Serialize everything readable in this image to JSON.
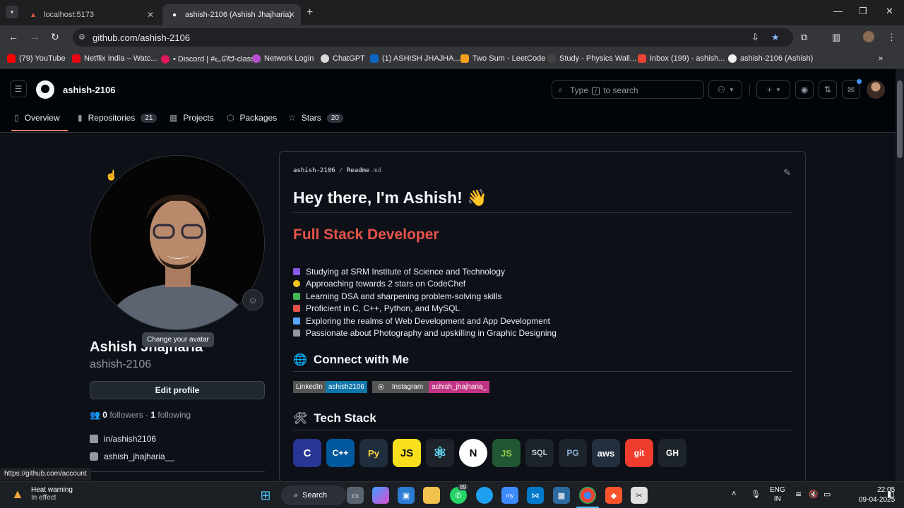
{
  "browser": {
    "tabs": [
      {
        "title": "localhost:5173",
        "active": false
      },
      {
        "title": "ashish-2106 (Ashish Jhajharia)",
        "active": true
      }
    ],
    "url": "github.com/ashish-2106",
    "bookmarks": [
      {
        "label": "(79) YouTube",
        "color": "#ff0000"
      },
      {
        "label": "Netflix India – Watc...",
        "color": "#e50914"
      },
      {
        "label": "• Discord | #ᓚᘏᗢ-class...",
        "color": "#e3165b"
      },
      {
        "label": "Network Login",
        "color": "#b84fd0"
      },
      {
        "label": "ChatGPT",
        "color": "#d9d9d9"
      },
      {
        "label": "(1) ASHISH JHAJHA...",
        "color": "#0a66c2"
      },
      {
        "label": "Two Sum - LeetCode",
        "color": "#f89f1b"
      },
      {
        "label": "Study - Physics Wall...",
        "color": "#444444"
      },
      {
        "label": "Inbox (199) - ashish...",
        "color": "#ea4335"
      },
      {
        "label": "ashish-2106 (Ashish)",
        "color": "#f0f0f0"
      }
    ]
  },
  "github": {
    "username": "ashish-2106",
    "search_placeholder_before": "Type",
    "search_key": "/",
    "search_placeholder_after": "to search",
    "tabs": [
      {
        "label": "Overview",
        "icon": "book-icon"
      },
      {
        "label": "Repositories",
        "icon": "repo-icon",
        "count": "21"
      },
      {
        "label": "Projects",
        "icon": "table-icon"
      },
      {
        "label": "Packages",
        "icon": "package-icon"
      },
      {
        "label": "Stars",
        "icon": "star-icon",
        "count": "20"
      }
    ]
  },
  "profile": {
    "name": "Ashish Jhajharia",
    "login": "ashish-2106",
    "tooltip": "Change your avatar",
    "edit_label": "Edit profile",
    "followers": "0",
    "followers_label": "followers",
    "following": "1",
    "following_label": "following",
    "linkedin": "in/ashish2106",
    "instagram": "ashish_jhajharia__"
  },
  "readme": {
    "path_user": "ashish-2106",
    "path_sep": "/",
    "path_file": "Readme",
    "path_ext": ".md",
    "heading": "Hey there, I'm Ashish! 👋",
    "role": "Full Stack Developer",
    "bullets": [
      {
        "text": "Studying at SRM Institute of Science and Technology",
        "color": "#8957e5"
      },
      {
        "text": "Approaching towards 2 stars on CodeChef",
        "color": "#f5c518"
      },
      {
        "text": "Learning DSA and sharpening problem-solving skills",
        "color": "#3fb950"
      },
      {
        "text": "Proficient in C, C++, Python, and MySQL",
        "color": "#e5534b"
      },
      {
        "text": "Exploring the realms of Web Development and App Development",
        "color": "#58a6ff"
      },
      {
        "text": "Passionate about Photography and upskilling in Graphic Designing",
        "color": "#9198a1"
      }
    ],
    "connect_heading": "Connect with Me",
    "badges": {
      "linkedin_left": "LinkedIn",
      "linkedin_right": "ashish2106",
      "instagram_left": "Instagram",
      "instagram_right": "ashish_jhajharia_"
    },
    "tech_heading": "Tech Stack",
    "tech": [
      {
        "label": "C",
        "color": "#283593"
      },
      {
        "label": "C++",
        "color": "#00599c"
      },
      {
        "label": "Py",
        "color": "#1f2d3d"
      },
      {
        "label": "JS",
        "color": "#f7df1e"
      },
      {
        "label": "⚛",
        "color": "#1d232a"
      },
      {
        "label": "N",
        "color": "#ffffff"
      },
      {
        "label": "JS",
        "color": "#215732"
      },
      {
        "label": "SQL",
        "color": "#1d232a"
      },
      {
        "label": "PG",
        "color": "#1d232a"
      },
      {
        "label": "aws",
        "color": "#232f3e"
      },
      {
        "label": "git",
        "color": "#f03c2e"
      },
      {
        "label": "GH",
        "color": "#1d232a"
      }
    ]
  },
  "status_url": "https://github.com/account",
  "taskbar": {
    "warning_title": "Heat warning",
    "warning_sub": "In effect",
    "search_label": "Search",
    "lang_top": "ENG",
    "lang_bottom": "IN",
    "time": "22:05",
    "date": "09-04-2025",
    "badge_count": "89"
  }
}
